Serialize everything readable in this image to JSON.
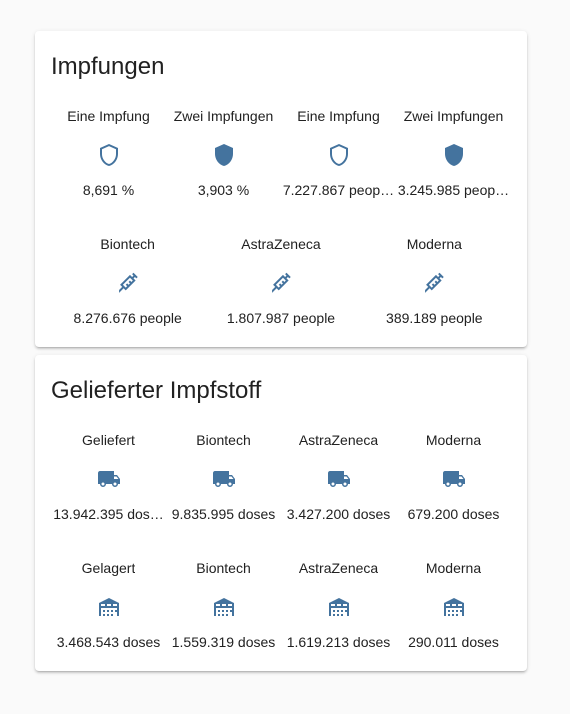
{
  "colors": {
    "icon": "#44739e",
    "background": "#fafafa",
    "card": "#ffffff",
    "text": "#212121"
  },
  "cards": {
    "impfungen": {
      "title": "Impfungen",
      "row1": [
        {
          "label": "Eine Impfung",
          "value": "8,691 %",
          "icon": "shield-outline-icon"
        },
        {
          "label": "Zwei Impfungen",
          "value": "3,903 %",
          "icon": "shield-icon"
        },
        {
          "label": "Eine Impfung",
          "value": "7.227.867 peop…",
          "icon": "shield-outline-icon"
        },
        {
          "label": "Zwei Impfungen",
          "value": "3.245.985 peop…",
          "icon": "shield-icon"
        }
      ],
      "row2": [
        {
          "label": "Biontech",
          "value": "8.276.676 people",
          "icon": "syringe-icon"
        },
        {
          "label": "AstraZeneca",
          "value": "1.807.987 people",
          "icon": "syringe-icon"
        },
        {
          "label": "Moderna",
          "value": "389.189 people",
          "icon": "syringe-icon"
        }
      ]
    },
    "geliefert": {
      "title": "Gelieferter Impfstoff",
      "row1": [
        {
          "label": "Geliefert",
          "value": "13.942.395 dos…",
          "icon": "truck-icon"
        },
        {
          "label": "Biontech",
          "value": "9.835.995 doses",
          "icon": "truck-icon"
        },
        {
          "label": "AstraZeneca",
          "value": "3.427.200 doses",
          "icon": "truck-icon"
        },
        {
          "label": "Moderna",
          "value": "679.200 doses",
          "icon": "truck-icon"
        }
      ],
      "row2": [
        {
          "label": "Gelagert",
          "value": "3.468.543 doses",
          "icon": "warehouse-icon"
        },
        {
          "label": "Biontech",
          "value": "1.559.319 doses",
          "icon": "warehouse-icon"
        },
        {
          "label": "AstraZeneca",
          "value": "1.619.213 doses",
          "icon": "warehouse-icon"
        },
        {
          "label": "Moderna",
          "value": "290.011 doses",
          "icon": "warehouse-icon"
        }
      ]
    }
  }
}
